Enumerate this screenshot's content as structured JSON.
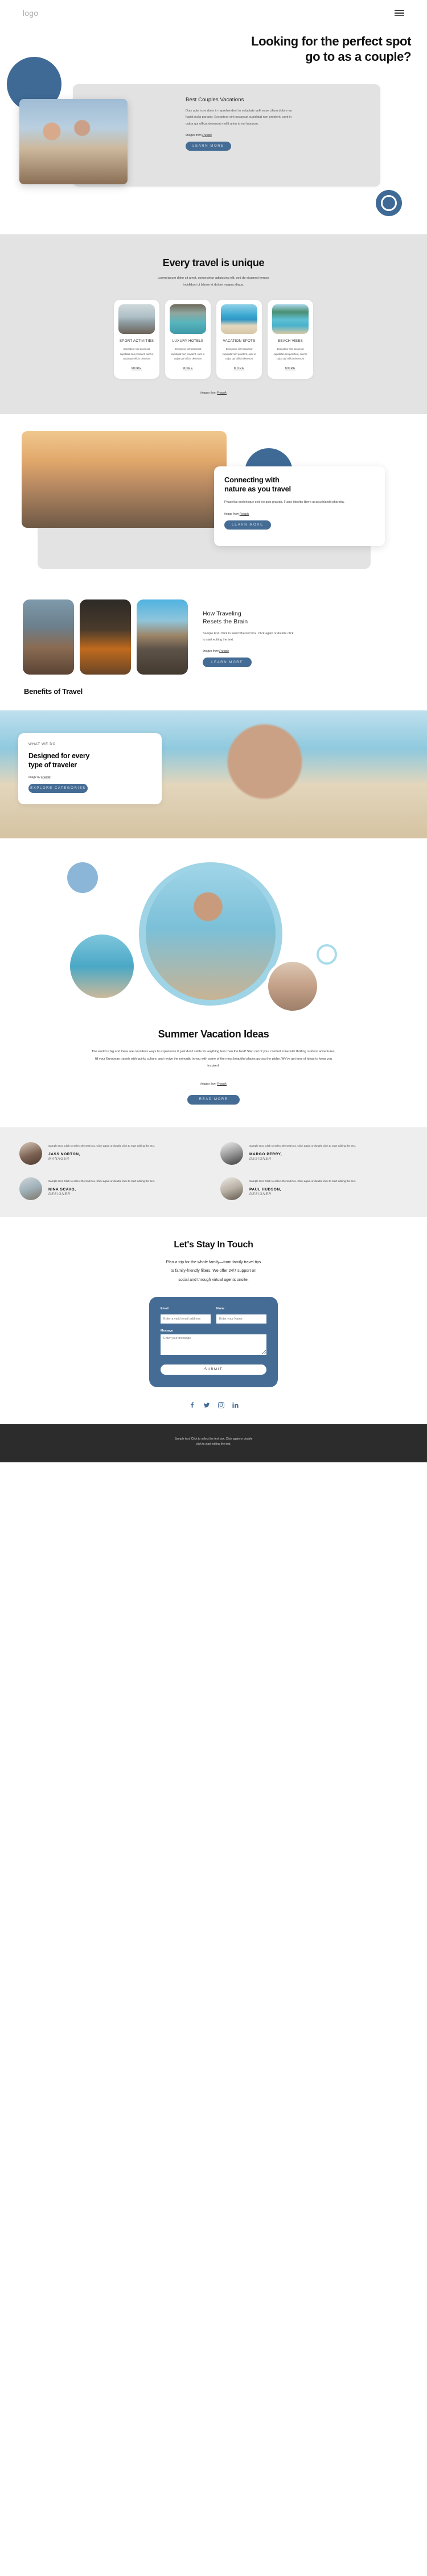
{
  "header": {
    "logo": "logo",
    "menu_icon": "hamburger-icon"
  },
  "hero": {
    "title_line1": "Looking for the perfect spot",
    "title_line2": "go to as a couple?",
    "card": {
      "heading": "Best Couples Vacations",
      "body": "Duis aute irure dolor in reprehenderit in voluptate velit esse cillum dolore eu fugiat nulla pariatur. Excepteur sint occaecat cupidatat non proident, sunt in culpa qui officia deserunt mollit anim id est laborum.",
      "credit_prefix": "Images from ",
      "credit_link": "Freepik",
      "cta": "LEARN MORE"
    }
  },
  "unique": {
    "title": "Every travel is unique",
    "subtitle_line1": "Lorem ipsum dolor sit amet, consectetur adipiscing elit, sed do eiusmod tempor",
    "subtitle_line2": "incididunt ut labore et dolore magna aliqua.",
    "card_desc": "Excepteur sint occaecat cupidatat non proident, sunt in culpa qui officia deserunt",
    "more_label": "MORE",
    "credit_prefix": "Images from ",
    "credit_link": "Freepik",
    "cards": [
      {
        "name": "SPORT ACTIVITIES",
        "image": "woman-stretching-on-beach-deck"
      },
      {
        "name": "LUXURY HOTELS",
        "image": "floating-breakfast-tray-in-pool"
      },
      {
        "name": "VACATION SPOTS",
        "image": "beach-umbrellas-and-loungers"
      },
      {
        "name": "BEACH VIBES",
        "image": "tropical-resort-pool-with-palms"
      }
    ]
  },
  "nature": {
    "heading_line1": "Connecting with",
    "heading_line2": "nature as you travel",
    "body": "Phasellus scelerisque sed leo quis gravida. Fusce lobortis libero ut arcu blandit pharetra.",
    "credit_prefix": "Image from ",
    "credit_link": "Freepik",
    "cta": "LEARN MORE",
    "image": "couple-with-map-and-bicycle-at-sunset"
  },
  "benefits": {
    "heading_line1": "How Traveling",
    "heading_line2": "Resets the Brain",
    "body": "Sample text. Click to select the text box. Click again or double click to start editing the text.",
    "credit_prefix": "Images from ",
    "credit_link": "Freepik",
    "cta": "LEARN MORE",
    "section_heading": "Benefits of Travel",
    "images": [
      "mountain-rocky-landscape",
      "campfire-at-night",
      "desert-highway-road"
    ]
  },
  "designed": {
    "eyebrow": "WHAT WE DO",
    "heading_line1": "Designed for every",
    "heading_line2": "type of traveler",
    "credit_prefix": "Image by ",
    "credit_link": "Freepik",
    "cta": "EXPLORE CATEGORIES",
    "background_image": "woman-in-straw-hat-lying-on-beach"
  },
  "summer": {
    "title": "Summer Vacation Ideas",
    "body": "The world is big and there are countless ways to experience it, just don’t settle for anything less than the best! Step out of your comfort zone with thrilling outdoor adventures, fill your European travels with quirky culture, and revive the nomadic in you with some of the most beautiful places across the globe. We’ve got tons of ideas to keep you inspired.",
    "credit_prefix": "Images from ",
    "credit_link": "Freepik",
    "cta": "READ MORE",
    "images": [
      "family-father-holding-child",
      "two-women-in-pool",
      "woman-in-bikini-portrait"
    ]
  },
  "testimonials": [
    {
      "quote": "Sample text. Click to select the text box. Click again or double click to start editing the text.",
      "name": "JASS NORTON,",
      "role": "MANAGER",
      "avatar": "portrait-man-beige"
    },
    {
      "quote": "Sample text. Click to select the text box. Click again or double click to start editing the text.",
      "name": "MARGO PERRY,",
      "role": "DESIGNER",
      "avatar": "portrait-woman-sunglasses-bw"
    },
    {
      "quote": "Sample text. Click to select the text box. Click again or double click to start editing the text.",
      "name": "NINA SCAVO,",
      "role": "DESIGNER",
      "avatar": "portrait-woman-grey"
    },
    {
      "quote": "Sample text. Click to select the text box. Click again or double click to start editing the text.",
      "name": "PAUL HUDSON,",
      "role": "DESIGNER",
      "avatar": "portrait-man-with-laptop"
    }
  ],
  "contact": {
    "title": "Let's Stay In Touch",
    "sub_line1": "Plan a trip for the whole family—from family travel tips",
    "sub_line2": "to family-friendly filters. We offer 24/7 support on",
    "sub_line3": "social and through virtual agents onsite.",
    "email_label": "Email",
    "email_placeholder": "Enter a valid email address",
    "email_value": "",
    "name_label": "Name",
    "name_placeholder": "Enter your Name",
    "name_value": "",
    "message_label": "Message",
    "message_placeholder": "Enter your message",
    "message_value": "",
    "submit_label": "SUBMIT"
  },
  "socials": [
    {
      "name": "facebook-icon"
    },
    {
      "name": "twitter-icon"
    },
    {
      "name": "instagram-icon"
    },
    {
      "name": "linkedin-icon"
    }
  ],
  "footer": {
    "text_line1": "Sample text. Click to select the text box. Click again or double",
    "text_line2": "click to start editing the text."
  },
  "colors": {
    "accent": "#456c94",
    "deep_blue": "#3f6a96",
    "light_blue": "#9ed4e6",
    "grey_bg": "#e3e3e3",
    "footer_bg": "#2c2c2c"
  }
}
